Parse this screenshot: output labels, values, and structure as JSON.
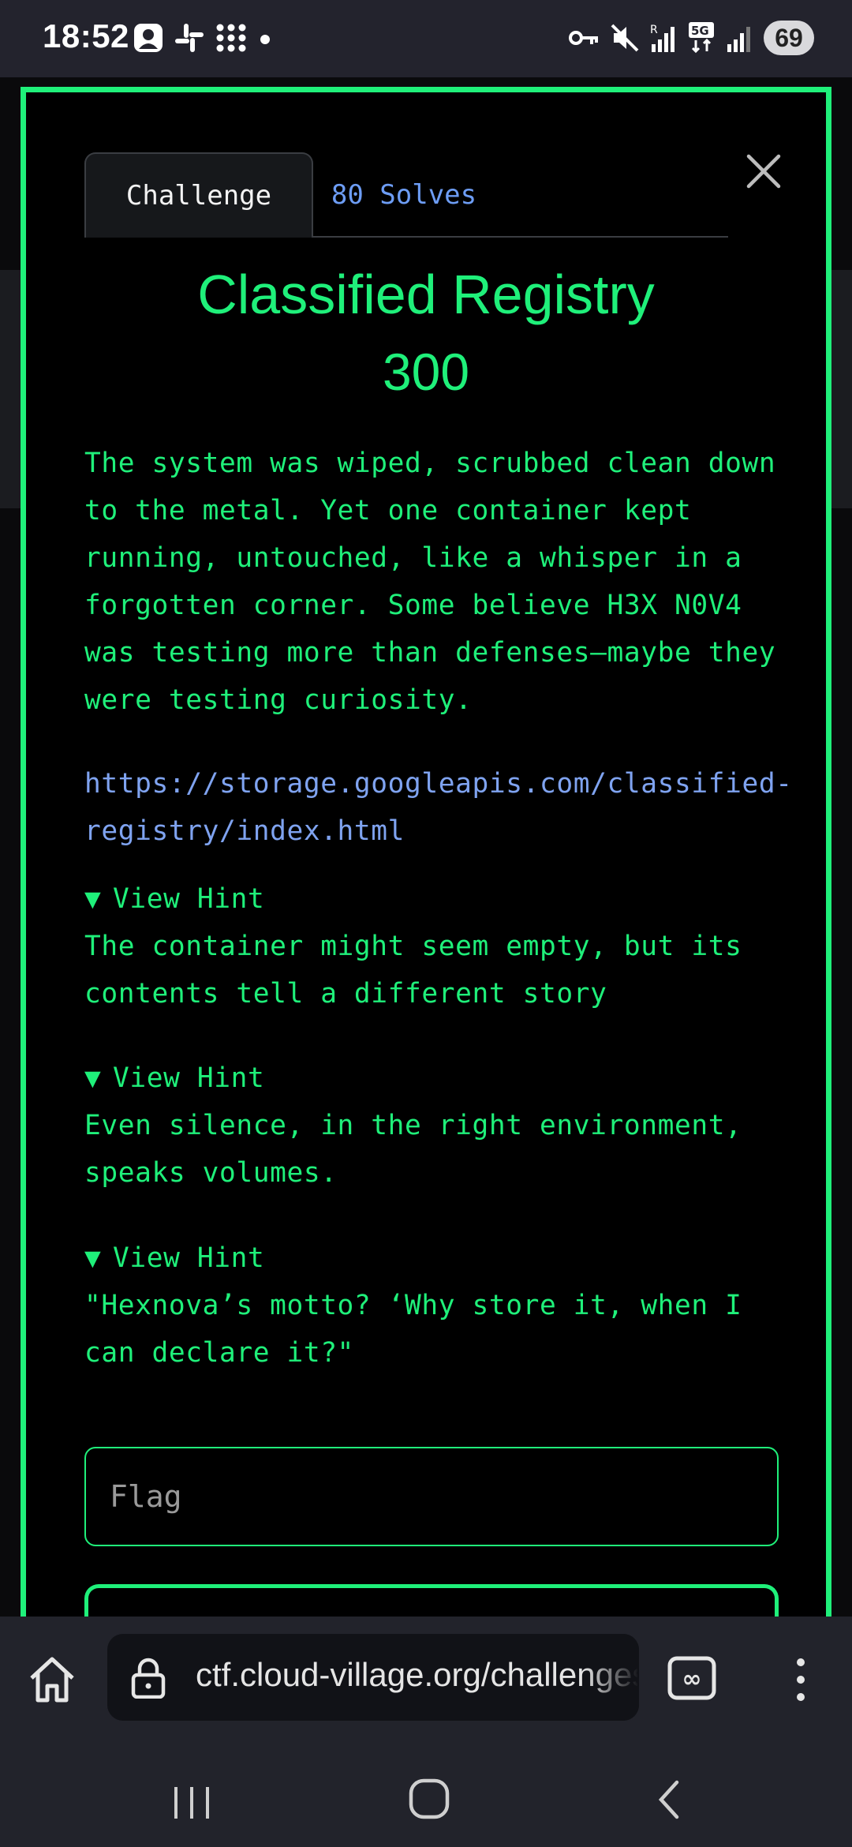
{
  "status_bar": {
    "time": "18:52",
    "battery": "69",
    "notification_icons": [
      "app-notification-icon",
      "slack-icon",
      "dots-grid-icon",
      "dot-icon"
    ],
    "system_icons": [
      "vpn-key-icon",
      "mute-icon",
      "wifi-calling-icon",
      "5g-icon",
      "signal-icon"
    ]
  },
  "modal": {
    "tabs": [
      {
        "label": "Challenge",
        "active": true
      },
      {
        "label": "80 Solves",
        "active": false
      }
    ],
    "close_icon": "close-icon",
    "title": "Classified Registry",
    "points": "300",
    "description": "The system was wiped, scrubbed clean down to the metal. Yet one container kept running, untouched, like a whisper in a forgotten corner. Some believe H3X N0V4 was testing more than defenses—maybe they were testing curiosity.",
    "link": "https://storage.googleapis.com/classified-registry/index.html",
    "hints": [
      {
        "summary": "View Hint",
        "text": "The container might seem empty, but its contents tell a different story"
      },
      {
        "summary": "View Hint",
        "text": "Even silence, in the right environment, speaks volumes."
      },
      {
        "summary": "View Hint",
        "text": "\"Hexnova’s motto? ‘Why store it, when I can declare it?\""
      }
    ],
    "flag_placeholder": "Flag",
    "accent_color": "#1ff07a",
    "link_color": "#7fa3f0"
  },
  "browser": {
    "url": "ctf.cloud-village.org/challenges",
    "icons": [
      "home-icon",
      "lock-icon",
      "tab-switcher-icon",
      "more-vert-icon"
    ]
  },
  "nav_bar": {
    "icons": [
      "recents-icon",
      "home-circle-icon",
      "back-icon"
    ]
  }
}
